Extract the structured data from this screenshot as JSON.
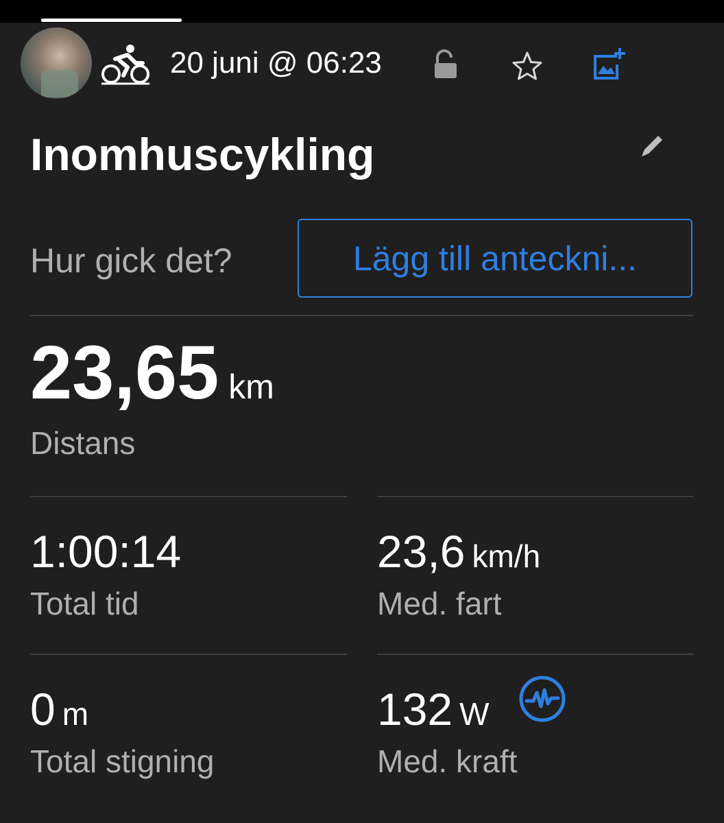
{
  "header": {
    "date_time": "20 juni @ 06:23",
    "icons": [
      "avatar",
      "cycling-icon",
      "unlock-icon",
      "star-icon",
      "add-photo-icon"
    ]
  },
  "activity": {
    "title": "Inomhuscykling",
    "prompt": "Hur gick det?",
    "note_button_label": "Lägg till anteckni..."
  },
  "stats": {
    "distance": {
      "value": "23,65",
      "unit": "km",
      "label": "Distans"
    },
    "total_time": {
      "value": "1:00:14",
      "label": "Total tid"
    },
    "avg_speed": {
      "value": "23,6",
      "unit": "km/h",
      "label": "Med. fart"
    },
    "elevation": {
      "value": "0",
      "unit": "m",
      "label": "Total stigning"
    },
    "avg_power": {
      "value": "132",
      "unit": "W",
      "label": "Med. kraft"
    }
  },
  "colors": {
    "background": "#1f1f1f",
    "accent": "#2f7fe0",
    "label_gray": "#b0b0b0",
    "divider": "#3d3d3d"
  }
}
